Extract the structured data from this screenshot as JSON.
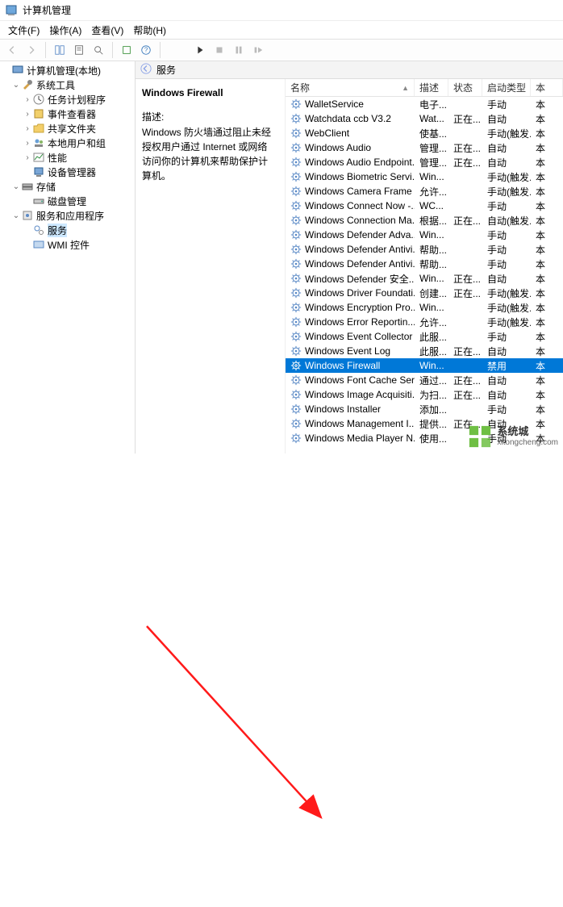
{
  "window": {
    "title": "计算机管理"
  },
  "menu": {
    "file": "文件(F)",
    "action": "操作(A)",
    "view": "查看(V)",
    "help": "帮助(H)"
  },
  "tree": {
    "root": "计算机管理(本地)",
    "system_tools": "系统工具",
    "task_scheduler": "任务计划程序",
    "event_viewer": "事件查看器",
    "shared_folders": "共享文件夹",
    "local_users": "本地用户和组",
    "performance": "性能",
    "device_manager": "设备管理器",
    "storage": "存储",
    "disk_mgmt": "磁盘管理",
    "services_apps": "服务和应用程序",
    "services": "服务",
    "wmi": "WMI 控件"
  },
  "services_panel": {
    "header_label": "服务",
    "selected_title": "Windows Firewall",
    "desc_label": "描述:",
    "desc_text": "Windows 防火墙通过阻止未经授权用户通过 Internet 或网络访问你的计算机来帮助保护计算机。"
  },
  "columns": {
    "name": "名称",
    "desc": "描述",
    "status": "状态",
    "startup": "启动类型",
    "ext": "本"
  },
  "rows": [
    {
      "name": "WalletService",
      "desc": "电子...",
      "status": "",
      "startup": "手动"
    },
    {
      "name": "Watchdata ccb V3.2",
      "desc": "Wat...",
      "status": "正在...",
      "startup": "自动"
    },
    {
      "name": "WebClient",
      "desc": "使基...",
      "status": "",
      "startup": "手动(触发..."
    },
    {
      "name": "Windows Audio",
      "desc": "管理...",
      "status": "正在...",
      "startup": "自动"
    },
    {
      "name": "Windows Audio Endpoint...",
      "desc": "管理...",
      "status": "正在...",
      "startup": "自动"
    },
    {
      "name": "Windows Biometric Servi...",
      "desc": "Win...",
      "status": "",
      "startup": "手动(触发..."
    },
    {
      "name": "Windows Camera Frame ...",
      "desc": "允许...",
      "status": "",
      "startup": "手动(触发..."
    },
    {
      "name": "Windows Connect Now -...",
      "desc": "WC...",
      "status": "",
      "startup": "手动"
    },
    {
      "name": "Windows Connection Ma...",
      "desc": "根据...",
      "status": "正在...",
      "startup": "自动(触发..."
    },
    {
      "name": "Windows Defender Adva...",
      "desc": "Win...",
      "status": "",
      "startup": "手动"
    },
    {
      "name": "Windows Defender Antivi...",
      "desc": "帮助...",
      "status": "",
      "startup": "手动"
    },
    {
      "name": "Windows Defender Antivi...",
      "desc": "帮助...",
      "status": "",
      "startup": "手动"
    },
    {
      "name": "Windows Defender 安全...",
      "desc": "Win...",
      "status": "正在...",
      "startup": "自动"
    },
    {
      "name": "Windows Driver Foundati...",
      "desc": "创建...",
      "status": "正在...",
      "startup": "手动(触发..."
    },
    {
      "name": "Windows Encryption Pro...",
      "desc": "Win...",
      "status": "",
      "startup": "手动(触发..."
    },
    {
      "name": "Windows Error Reportin...",
      "desc": "允许...",
      "status": "",
      "startup": "手动(触发..."
    },
    {
      "name": "Windows Event Collector",
      "desc": "此服...",
      "status": "",
      "startup": "手动"
    },
    {
      "name": "Windows Event Log",
      "desc": "此服...",
      "status": "正在...",
      "startup": "自动"
    },
    {
      "name": "Windows Firewall",
      "desc": "Win...",
      "status": "",
      "startup": "禁用",
      "selected": true
    },
    {
      "name": "Windows Font Cache Ser...",
      "desc": "通过...",
      "status": "正在...",
      "startup": "自动"
    },
    {
      "name": "Windows Image Acquisiti...",
      "desc": "为扫...",
      "status": "正在...",
      "startup": "自动"
    },
    {
      "name": "Windows Installer",
      "desc": "添加...",
      "status": "",
      "startup": "手动"
    },
    {
      "name": "Windows Management I...",
      "desc": "提供...",
      "status": "正在...",
      "startup": "自动"
    },
    {
      "name": "Windows Media Player N...",
      "desc": "使用...",
      "status": "",
      "startup": "手动"
    }
  ],
  "watermark": {
    "brand": "系统城",
    "url": "xitongcheng.com"
  }
}
